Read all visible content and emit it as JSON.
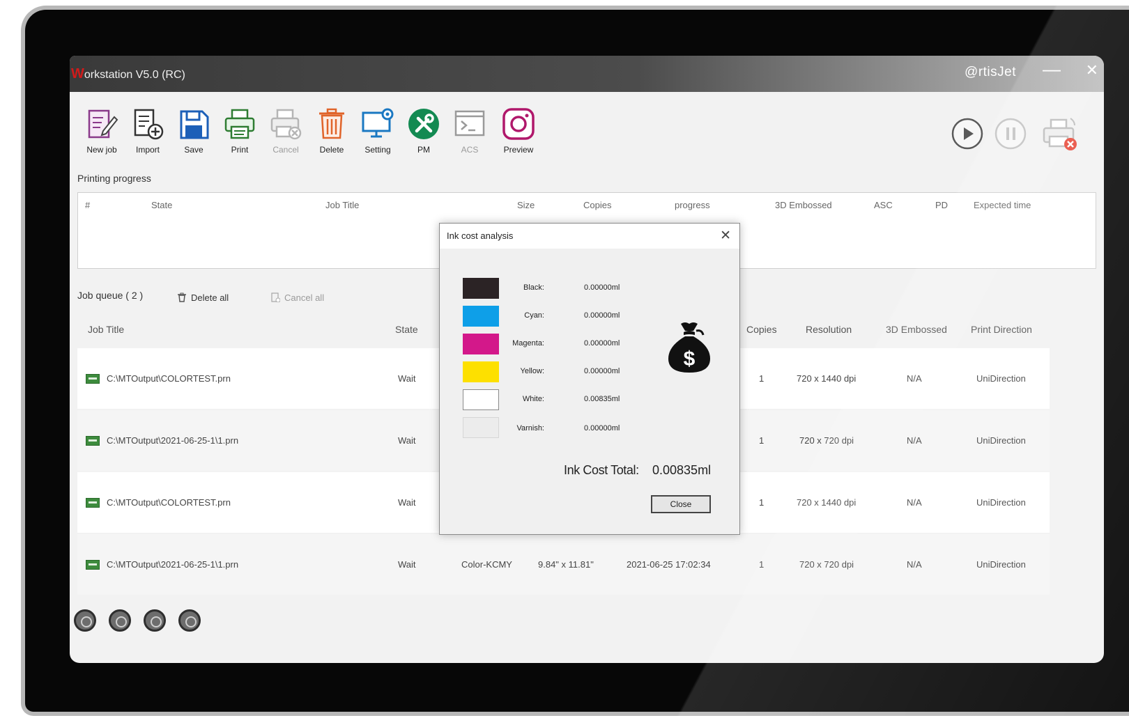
{
  "window": {
    "title_initial": "W",
    "title_rest": "orkstation V5.0 (RC)",
    "brand": "@rtisJet",
    "minimize_glyph": "—",
    "close_glyph": "✕"
  },
  "toolbar": {
    "items": [
      {
        "label": "New job",
        "icon": "new-job-icon"
      },
      {
        "label": "Import",
        "icon": "import-icon"
      },
      {
        "label": "Save",
        "icon": "save-icon"
      },
      {
        "label": "Print",
        "icon": "print-icon"
      },
      {
        "label": "Cancel",
        "icon": "cancel-print-icon"
      },
      {
        "label": "Delete",
        "icon": "trash-icon"
      },
      {
        "label": "Setting",
        "icon": "monitor-gear-icon"
      },
      {
        "label": "PM",
        "icon": "tools-icon"
      },
      {
        "label": "ACS",
        "icon": "terminal-icon"
      },
      {
        "label": "Preview",
        "icon": "camera-icon"
      }
    ]
  },
  "controls": {
    "play": "play-icon",
    "pause": "pause-icon",
    "printer_status": "printer-error-icon"
  },
  "progress": {
    "label": "Printing progress",
    "columns": [
      "#",
      "State",
      "Job Title",
      "Size",
      "Copies",
      "progress",
      "3D Embossed",
      "ASC",
      "PD",
      "Expected time"
    ]
  },
  "queue": {
    "label": "Job queue ( 2 )",
    "delete_all": "Delete all",
    "cancel_all": "Cancel all",
    "columns": [
      "Job Title",
      "State",
      "Copies",
      "Resolution",
      "3D Embossed",
      "Print Direction"
    ],
    "rows": [
      {
        "title": "C:\\MTOutput\\COLORTEST.prn",
        "state": "Wait",
        "color": "",
        "size": "",
        "time": "",
        "copies": "1",
        "resolution": "720 x 1440 dpi",
        "embossed": "N/A",
        "direction": "UniDirection"
      },
      {
        "title": "C:\\MTOutput\\2021-06-25-1\\1.prn",
        "state": "Wait",
        "color": "",
        "size": "",
        "time": "",
        "copies": "1",
        "resolution": "720 x 720 dpi",
        "embossed": "N/A",
        "direction": "UniDirection"
      },
      {
        "title": "C:\\MTOutput\\COLORTEST.prn",
        "state": "Wait",
        "color": "",
        "size": "",
        "time": "",
        "copies": "1",
        "resolution": "720 x 1440 dpi",
        "embossed": "N/A",
        "direction": "UniDirection"
      },
      {
        "title": "C:\\MTOutput\\2021-06-25-1\\1.prn",
        "state": "Wait",
        "color": "Color-KCMY",
        "size": "9.84\" x 11.81\"",
        "time": "2021-06-25 17:02:34",
        "copies": "1",
        "resolution": "720 x 720 dpi",
        "embossed": "N/A",
        "direction": "UniDirection"
      }
    ]
  },
  "dialog": {
    "title": "Ink cost analysis",
    "close_glyph": "✕",
    "inks": [
      {
        "label": "Black:",
        "value": "0.00000ml",
        "color": "#2b2325"
      },
      {
        "label": "Cyan:",
        "value": "0.00000ml",
        "color": "#0e9fe8"
      },
      {
        "label": "Magenta:",
        "value": "0.00000ml",
        "color": "#d3188a"
      },
      {
        "label": "Yellow:",
        "value": "0.00000ml",
        "color": "#fde000"
      },
      {
        "label": "White:",
        "value": "0.00835ml",
        "color": "#ffffff"
      },
      {
        "label": "Varnish:",
        "value": "0.00000ml",
        "color": "#ececec"
      }
    ],
    "total_label": "Ink Cost Total:",
    "total_value": "0.00835ml",
    "close_button": "Close",
    "icon": "money-bag-icon"
  },
  "footer": {
    "icons": [
      "settings-circle-icon",
      "palette-circle-icon",
      "image-circle-icon",
      "folder-circle-icon"
    ]
  }
}
